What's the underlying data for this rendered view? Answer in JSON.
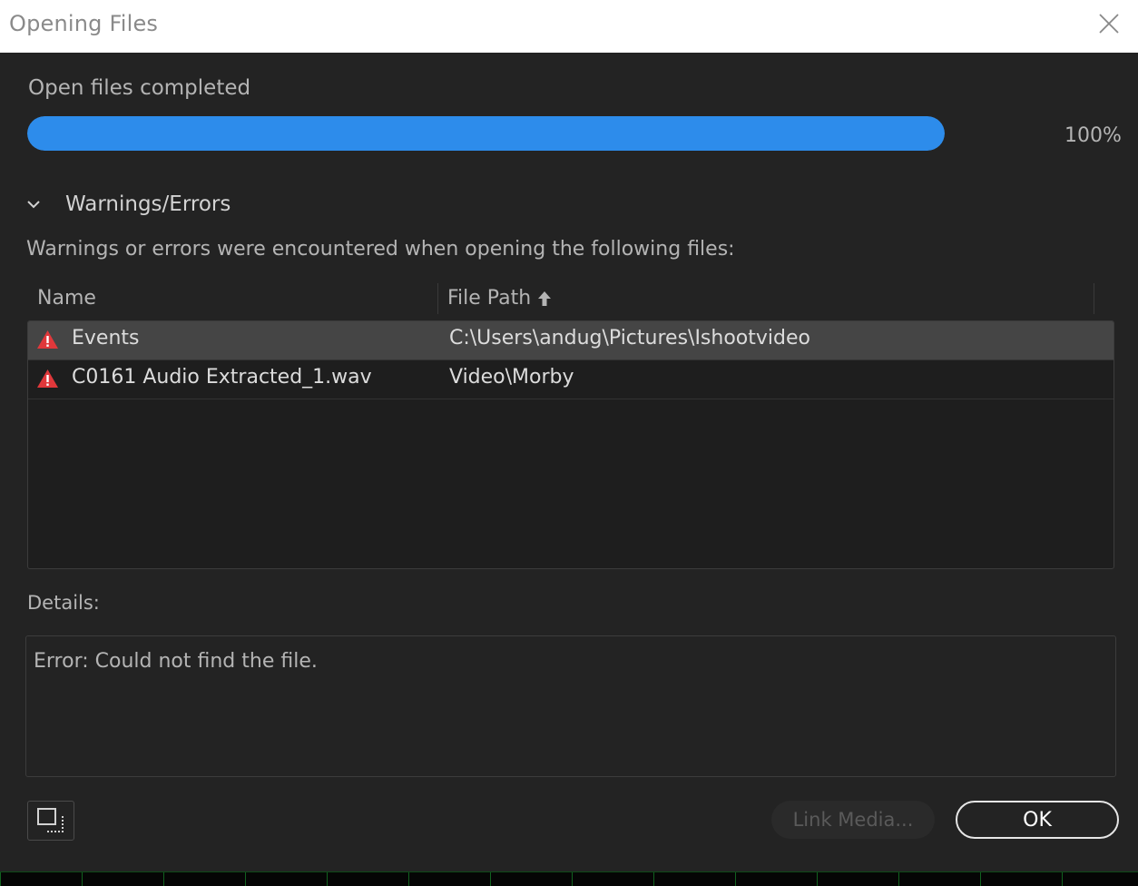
{
  "dialog": {
    "title": "Opening Files"
  },
  "progress": {
    "status": "Open files completed",
    "percent_label": "100%",
    "value": 1.0,
    "color": "#2d8ceb"
  },
  "section": {
    "label": "Warnings/Errors",
    "expanded": true,
    "description": "Warnings or errors were encountered when opening the following files:"
  },
  "table": {
    "columns": [
      "Name",
      "File Path"
    ],
    "sorted_column": "File Path",
    "sort_direction": "ascending",
    "rows": [
      {
        "icon": "warning-icon",
        "name": "Events",
        "path": "C:\\Users\\andug\\Pictures\\Ishootvideo",
        "selected": true
      },
      {
        "icon": "warning-icon",
        "name": "C0161 Audio Extracted_1.wav",
        "path": "Video\\Morby",
        "selected": false
      }
    ]
  },
  "details": {
    "label": "Details:",
    "text": "Error: Could not find the file."
  },
  "buttons": {
    "link_media": "Link Media...",
    "ok": "OK"
  },
  "colors": {
    "warning": "#e0383b",
    "accent": "#2d8ceb"
  }
}
